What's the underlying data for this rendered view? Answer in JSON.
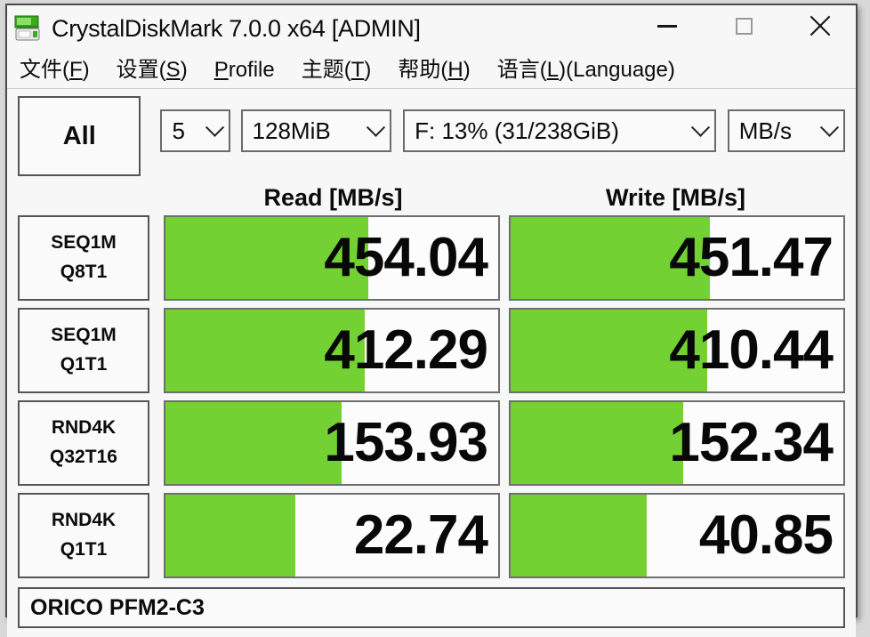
{
  "window": {
    "title": "CrystalDiskMark 7.0.0 x64 [ADMIN]",
    "icon": "disk-drive-icon",
    "controls": {
      "minimize": "minimize-icon",
      "maximize": "maximize-icon",
      "close": "close-icon"
    }
  },
  "menu": {
    "items": [
      {
        "label": "文件(F)",
        "accel": "F"
      },
      {
        "label": "设置(S)",
        "accel": "S"
      },
      {
        "label": "Profile",
        "accel": "P"
      },
      {
        "label": "主题(T)",
        "accel": "T"
      },
      {
        "label": "帮助(H)",
        "accel": "H"
      },
      {
        "label": "语言(L)(Language)",
        "accel": "L"
      }
    ]
  },
  "toolbar": {
    "all_button": "All",
    "runs": "5",
    "test_size": "128MiB",
    "drive": "F: 13% (31/238GiB)",
    "unit": "MB/s",
    "chevron_icon": "chevron-down-icon"
  },
  "table": {
    "headers": {
      "read": "Read [MB/s]",
      "write": "Write [MB/s]"
    },
    "rows": [
      {
        "name_line1": "SEQ1M",
        "name_line2": "Q8T1",
        "read": "454.04",
        "write": "451.47",
        "read_pct": 61,
        "write_pct": 60
      },
      {
        "name_line1": "SEQ1M",
        "name_line2": "Q1T1",
        "read": "412.29",
        "write": "410.44",
        "read_pct": 60,
        "write_pct": 59
      },
      {
        "name_line1": "RND4K",
        "name_line2": "Q32T16",
        "read": "153.93",
        "write": "152.34",
        "read_pct": 53,
        "write_pct": 52
      },
      {
        "name_line1": "RND4K",
        "name_line2": "Q1T1",
        "read": "22.74",
        "write": "40.85",
        "read_pct": 39,
        "write_pct": 41
      }
    ]
  },
  "status": {
    "device": "ORICO PFM2-C3"
  },
  "colors": {
    "bar_green": "#74d134",
    "window_bg": "#f7f7f7",
    "text": "#0b0b0b"
  },
  "chart_data": {
    "type": "bar",
    "title": "CrystalDiskMark 7.0.0 x64 — ORICO PFM2-C3",
    "xlabel": "",
    "ylabel": "MB/s",
    "categories": [
      "SEQ1M Q8T1",
      "SEQ1M Q1T1",
      "RND4K Q32T16",
      "RND4K Q1T1"
    ],
    "series": [
      {
        "name": "Read [MB/s]",
        "values": [
          454.04,
          412.29,
          153.93,
          22.74
        ]
      },
      {
        "name": "Write [MB/s]",
        "values": [
          451.47,
          410.44,
          152.34,
          40.85
        ]
      }
    ],
    "legend_position": "top",
    "grid": false,
    "unit": "MB/s",
    "test_size": "128MiB",
    "runs": 5,
    "drive": "F: 13% (31/238GiB)"
  }
}
